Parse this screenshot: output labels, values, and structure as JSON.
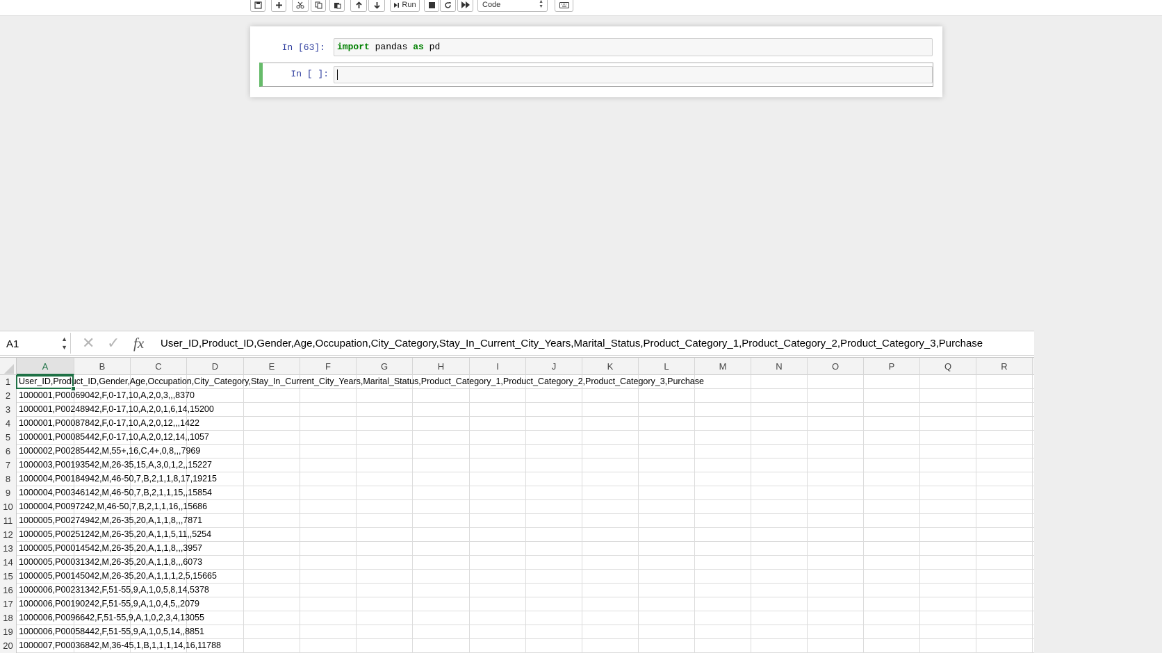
{
  "toolbar": {
    "buttons": [
      {
        "name": "save-button",
        "icon": "floppy-icon"
      },
      {
        "name": "insert-cell-button",
        "icon": "plus-icon"
      },
      {
        "name": "cut-button",
        "icon": "scissors-icon"
      },
      {
        "name": "copy-button",
        "icon": "copy-icon"
      },
      {
        "name": "paste-button",
        "icon": "paste-icon"
      },
      {
        "name": "move-up-button",
        "icon": "arrow-up-icon"
      },
      {
        "name": "move-down-button",
        "icon": "arrow-down-icon"
      },
      {
        "name": "stop-button",
        "icon": "stop-icon"
      },
      {
        "name": "restart-button",
        "icon": "refresh-icon"
      },
      {
        "name": "restart-run-all-button",
        "icon": "fast-forward-icon"
      },
      {
        "name": "keyboard-shortcuts-button",
        "icon": "keyboard-icon"
      }
    ],
    "run_label": "Run",
    "cell_type": "Code"
  },
  "notebook": {
    "cells": [
      {
        "prompt": "In [63]:",
        "code_kw1": "import",
        "code_mid": " pandas ",
        "code_kw2": "as",
        "code_end": " pd"
      },
      {
        "prompt": "In [ ]:",
        "code": ""
      }
    ]
  },
  "spreadsheet": {
    "name_box": "A1",
    "formula": "User_ID,Product_ID,Gender,Age,Occupation,City_Category,Stay_In_Current_City_Years,Marital_Status,Product_Category_1,Product_Category_2,Product_Category_3,Purchase",
    "columns": [
      "A",
      "B",
      "C",
      "D",
      "E",
      "F",
      "G",
      "H",
      "I",
      "J",
      "K",
      "L",
      "M",
      "N",
      "O",
      "P",
      "Q",
      "R"
    ],
    "rows": [
      {
        "num": "1",
        "value": "User_ID,Product_ID,Gender,Age,Occupation,City_Category,Stay_In_Current_City_Years,Marital_Status,Product_Category_1,Product_Category_2,Product_Category_3,Purchase"
      },
      {
        "num": "2",
        "value": "1000001,P00069042,F,0-17,10,A,2,0,3,,,8370"
      },
      {
        "num": "3",
        "value": "1000001,P00248942,F,0-17,10,A,2,0,1,6,14,15200"
      },
      {
        "num": "4",
        "value": "1000001,P00087842,F,0-17,10,A,2,0,12,,,1422"
      },
      {
        "num": "5",
        "value": "1000001,P00085442,F,0-17,10,A,2,0,12,14,,1057"
      },
      {
        "num": "6",
        "value": "1000002,P00285442,M,55+,16,C,4+,0,8,,,7969"
      },
      {
        "num": "7",
        "value": "1000003,P00193542,M,26-35,15,A,3,0,1,2,,15227"
      },
      {
        "num": "8",
        "value": "1000004,P00184942,M,46-50,7,B,2,1,1,8,17,19215"
      },
      {
        "num": "9",
        "value": "1000004,P00346142,M,46-50,7,B,2,1,1,15,,15854"
      },
      {
        "num": "10",
        "value": "1000004,P0097242,M,46-50,7,B,2,1,1,16,,15686"
      },
      {
        "num": "11",
        "value": "1000005,P00274942,M,26-35,20,A,1,1,8,,,7871"
      },
      {
        "num": "12",
        "value": "1000005,P00251242,M,26-35,20,A,1,1,5,11,,5254"
      },
      {
        "num": "13",
        "value": "1000005,P00014542,M,26-35,20,A,1,1,8,,,3957"
      },
      {
        "num": "14",
        "value": "1000005,P00031342,M,26-35,20,A,1,1,8,,,6073"
      },
      {
        "num": "15",
        "value": "1000005,P00145042,M,26-35,20,A,1,1,1,2,5,15665"
      },
      {
        "num": "16",
        "value": "1000006,P00231342,F,51-55,9,A,1,0,5,8,14,5378"
      },
      {
        "num": "17",
        "value": "1000006,P00190242,F,51-55,9,A,1,0,4,5,,2079"
      },
      {
        "num": "18",
        "value": "1000006,P0096642,F,51-55,9,A,1,0,2,3,4,13055"
      },
      {
        "num": "19",
        "value": "1000006,P00058442,F,51-55,9,A,1,0,5,14,,8851"
      },
      {
        "num": "20",
        "value": "1000007,P00036842,M,36-45,1,B,1,1,1,14,16,11788"
      }
    ]
  },
  "colors": {
    "accent_green": "#1e7145",
    "edit_mode_green": "#66bb6a",
    "prompt_blue": "#303f9f",
    "keyword_green": "#008000"
  }
}
